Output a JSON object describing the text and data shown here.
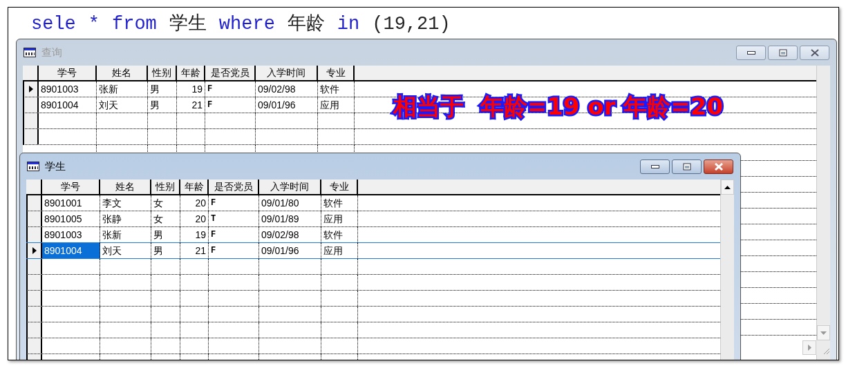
{
  "sql": [
    {
      "kind": "keyword",
      "text": "sele"
    },
    {
      "kind": "keyword",
      "text": "*"
    },
    {
      "kind": "keyword",
      "text": "from"
    },
    {
      "kind": "text",
      "text": "学生"
    },
    {
      "kind": "keyword",
      "text": "where"
    },
    {
      "kind": "text",
      "text": "年龄"
    },
    {
      "kind": "keyword",
      "text": "in"
    },
    {
      "kind": "text",
      "text": "(19,21)"
    }
  ],
  "windows": [
    {
      "title": "查询",
      "active": false,
      "columns": [
        "学号",
        "姓名",
        "性别",
        "年龄",
        "是否党员",
        "入学时间",
        "专业"
      ],
      "rows": [
        {
          "cells": [
            "8901003",
            "张新",
            "男",
            "19",
            "F",
            "09/02/98",
            "软件"
          ],
          "current": true
        },
        {
          "cells": [
            "8901004",
            "刘天",
            "男",
            "21",
            "F",
            "09/01/96",
            "应用"
          ],
          "current": false
        }
      ]
    },
    {
      "title": "学生",
      "active": true,
      "columns": [
        "学号",
        "姓名",
        "性别",
        "年龄",
        "是否党员",
        "入学时间",
        "专业"
      ],
      "rows": [
        {
          "cells": [
            "8901001",
            "李文",
            "女",
            "20",
            "F",
            "09/01/80",
            "软件"
          ],
          "current": false
        },
        {
          "cells": [
            "8901005",
            "张静",
            "女",
            "20",
            "T",
            "09/01/89",
            "应用"
          ],
          "current": false
        },
        {
          "cells": [
            "8901003",
            "张新",
            "男",
            "19",
            "F",
            "09/02/98",
            "软件"
          ],
          "current": false
        },
        {
          "cells": [
            "8901004",
            "刘天",
            "男",
            "21",
            "F",
            "09/01/96",
            "应用"
          ],
          "current": true
        }
      ]
    }
  ],
  "note": "相当于  年龄=19 or 年龄=20"
}
